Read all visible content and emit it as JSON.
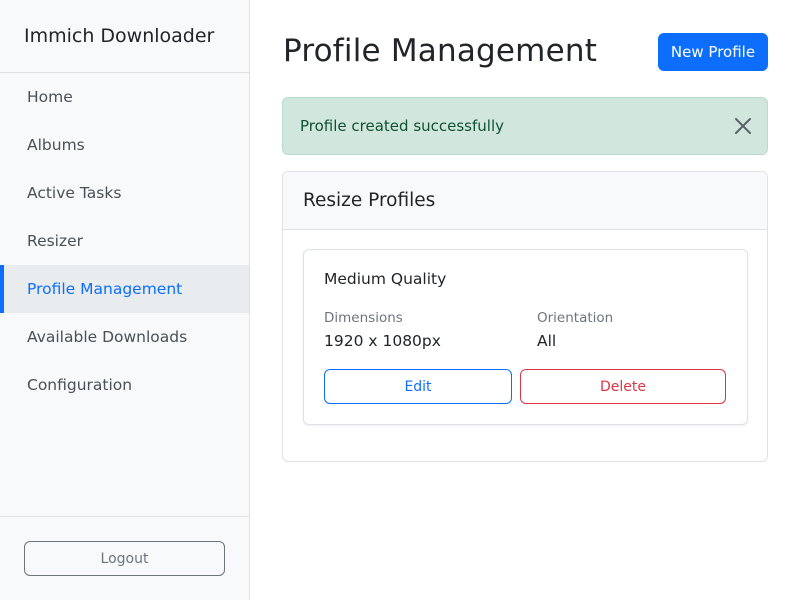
{
  "sidebar": {
    "brand": "Immich Downloader",
    "items": [
      {
        "label": "Home"
      },
      {
        "label": "Albums"
      },
      {
        "label": "Active Tasks"
      },
      {
        "label": "Resizer"
      },
      {
        "label": "Profile Management"
      },
      {
        "label": "Available Downloads"
      },
      {
        "label": "Configuration"
      }
    ],
    "active_index": 4,
    "logout_label": "Logout"
  },
  "header": {
    "title": "Profile Management",
    "new_profile_label": "New Profile"
  },
  "alert": {
    "message": "Profile created successfully",
    "close_icon": "close-icon"
  },
  "profiles_card": {
    "title": "Resize Profiles",
    "profiles": [
      {
        "name": "Medium Quality",
        "dimensions_label": "Dimensions",
        "dimensions_value": "1920 x 1080px",
        "orientation_label": "Orientation",
        "orientation_value": "All",
        "edit_label": "Edit",
        "delete_label": "Delete"
      }
    ]
  },
  "colors": {
    "primary": "#0d6efd",
    "danger": "#dc3545",
    "success_bg": "#d1e7dd",
    "secondary": "#6c757d"
  }
}
